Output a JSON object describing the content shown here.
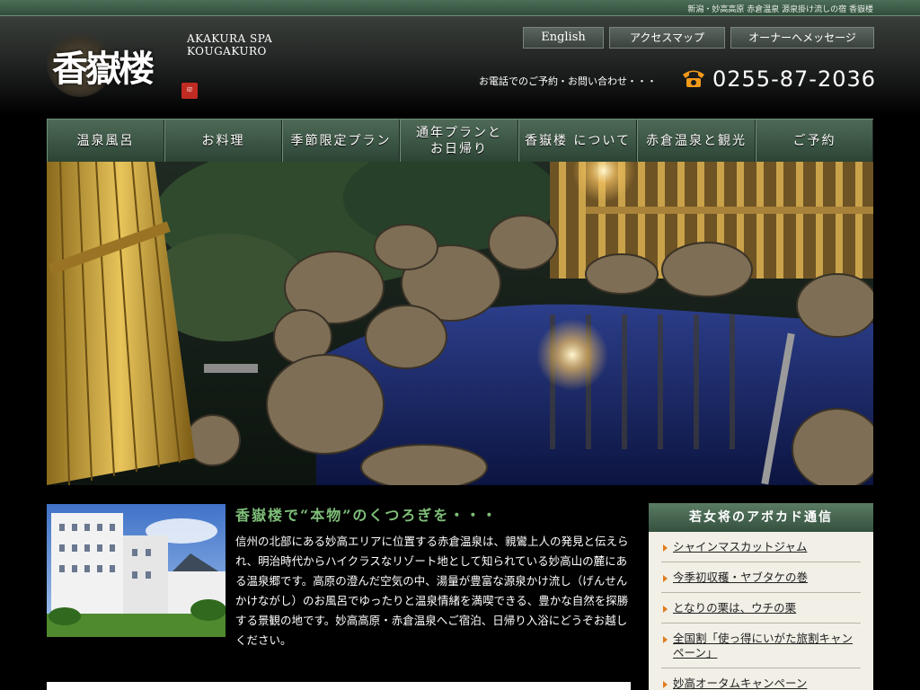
{
  "topstrip": {
    "tagline": "新潟・妙高高原 赤倉温泉 源泉掛け流しの宿 香嶽楼"
  },
  "header": {
    "logo_text": "香嶽楼",
    "brand_en_1": "AKAKURA SPA",
    "brand_en_2": "KOUGAKURO",
    "topnav": [
      "English",
      "アクセスマップ",
      "オーナーへメッセージ"
    ],
    "phone_label": "お電話でのご予約・お問い合わせ・・・",
    "phone_number": "0255-87-2036"
  },
  "mainnav": [
    "温泉風呂",
    "お料理",
    "季節限定プラン",
    "通年プランと\nお日帰り",
    "香嶽楼 について",
    "赤倉温泉と観光",
    "ご予約"
  ],
  "content": {
    "headline": "香嶽楼で“本物”のくつろぎを・・・",
    "intro": "信州の北部にある妙高エリアに位置する赤倉温泉は、親鸞上人の発見と伝えられ、明治時代からハイクラスなリゾート地として知られている妙高山の麓にある温泉郷です。高原の澄んだ空気の中、湯量が豊富な源泉かけ流し（げんせんかけながし）のお風呂でゆったりと温泉情緒を満喫できる、豊かな自然を探勝する景観の地です。妙高高原・赤倉温泉へご宿泊、日帰り入浴にどうぞお越しください。"
  },
  "blog": {
    "title": "若女将のアボカド通信",
    "items": [
      "シャインマスカットジャム",
      "今季初収穫・ヤブタケの巻",
      "となりの栗は、ウチの栗",
      "全国割「使っ得にいがた旅割キャンペーン」",
      "妙高オータムキャンペーン"
    ]
  },
  "colors": {
    "accent_green": "#4e6a57",
    "headline_green": "#7fbf79",
    "bullet_orange": "#e07b1c"
  }
}
